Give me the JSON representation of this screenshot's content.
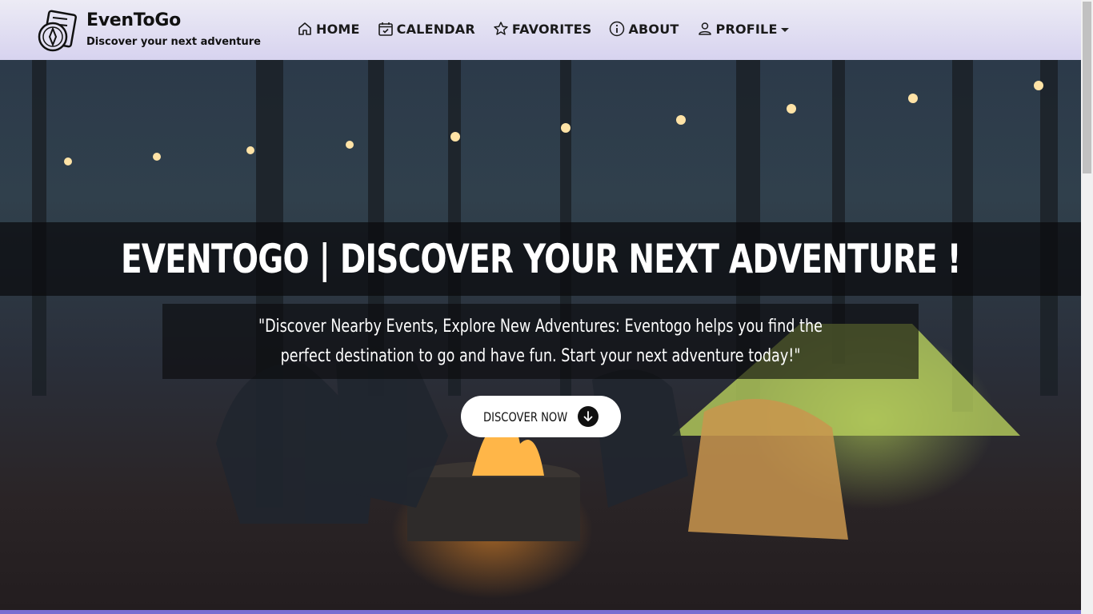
{
  "brand": {
    "name": "EvenToGo",
    "tagline": "Discover your next adventure"
  },
  "nav": {
    "items": [
      {
        "label": "HOME",
        "icon": "home-icon"
      },
      {
        "label": "CALENDAR",
        "icon": "calendar-icon"
      },
      {
        "label": "FAVORITES",
        "icon": "star-icon"
      },
      {
        "label": "ABOUT",
        "icon": "info-icon"
      },
      {
        "label": "PROFILE",
        "icon": "user-icon"
      }
    ]
  },
  "hero": {
    "title": "EVENTOGO | DISCOVER YOUR NEXT ADVENTURE !",
    "subtitle": "\"Discover Nearby Events, Explore New Adventures: Eventogo helps you find the perfect destination to go and have fun. Start your next adventure today!\"",
    "cta_label": "DISCOVER NOW",
    "cta_icon": "arrow-down-circle-icon"
  },
  "colors": {
    "navbar_top": "#ecebf5",
    "navbar_bottom": "#d7d3ef",
    "accent": "#7a6fd0"
  }
}
